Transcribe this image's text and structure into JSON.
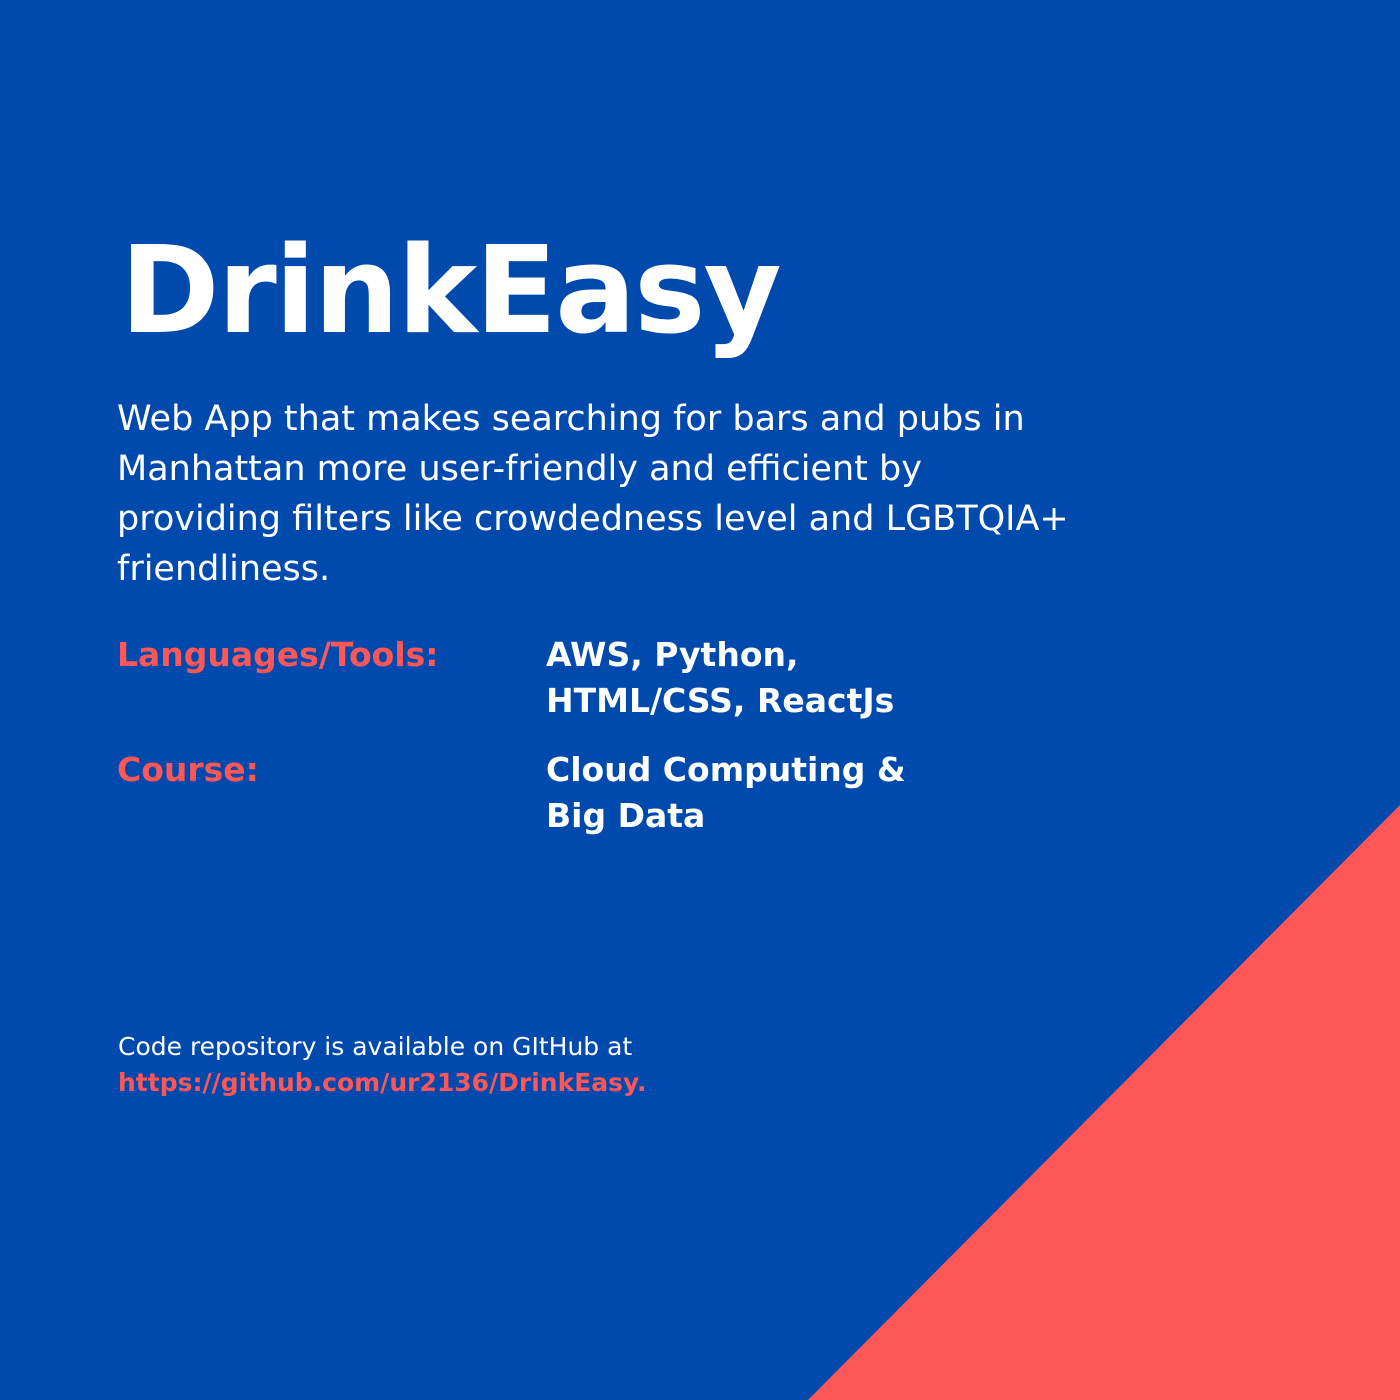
{
  "colors": {
    "background": "#004aad",
    "accent": "#ff5757",
    "text": "#ffffff"
  },
  "title": "DrinkEasy",
  "description": "Web App that makes searching for bars and pubs in Manhattan more user-friendly and efficient by providing filters like crowdedness level and LGBTQIA+ friendliness.",
  "details": {
    "languages_label": "Languages/Tools:",
    "languages_value_line1": "AWS, Python,",
    "languages_value_line2": "HTML/CSS, ReactJs",
    "course_label": "Course:",
    "course_value_line1": "Cloud Computing &",
    "course_value_line2": "Big Data"
  },
  "repository": {
    "text": "Code repository is available on GItHub at",
    "link": "https://github.com/ur2136/DrinkEasy."
  }
}
